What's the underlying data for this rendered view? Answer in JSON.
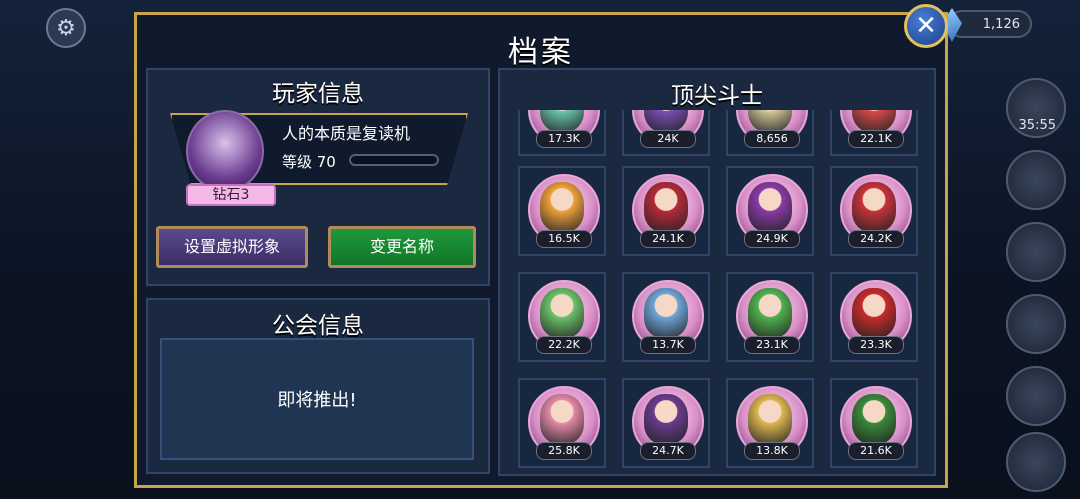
{
  "hud": {
    "gem_count": "1,126",
    "timer": "35:55"
  },
  "dialog": {
    "title": "档案"
  },
  "player": {
    "section_title": "玩家信息",
    "name": "人的本质是复读机",
    "level_label": "等级 70",
    "rank": "钻石3",
    "set_avatar_button": "设置虚拟形象",
    "rename_button": "变更名称"
  },
  "guild": {
    "section_title": "公会信息",
    "status": "即将推出!"
  },
  "fighters": {
    "section_title": "顶尖斗士",
    "items": [
      {
        "score": "17.3K",
        "color": "#6bc8b0"
      },
      {
        "score": "24K",
        "color": "#7b4fb8"
      },
      {
        "score": "8,656",
        "color": "#d6c79a"
      },
      {
        "score": "22.1K",
        "color": "#d94a4a"
      },
      {
        "score": "16.5K",
        "color": "#f0a23a"
      },
      {
        "score": "24.1K",
        "color": "#b52a3a"
      },
      {
        "score": "24.9K",
        "color": "#8a3aa8"
      },
      {
        "score": "24.2K",
        "color": "#c8323a"
      },
      {
        "score": "22.2K",
        "color": "#6cc26a"
      },
      {
        "score": "13.7K",
        "color": "#6fa6d8"
      },
      {
        "score": "23.1K",
        "color": "#4fb34f"
      },
      {
        "score": "23.3K",
        "color": "#c82a2a"
      },
      {
        "score": "25.8K",
        "color": "#e58aa8"
      },
      {
        "score": "24.7K",
        "color": "#6a3b8e"
      },
      {
        "score": "13.8K",
        "color": "#e0b850"
      },
      {
        "score": "21.6K",
        "color": "#3a8a3a"
      }
    ]
  }
}
